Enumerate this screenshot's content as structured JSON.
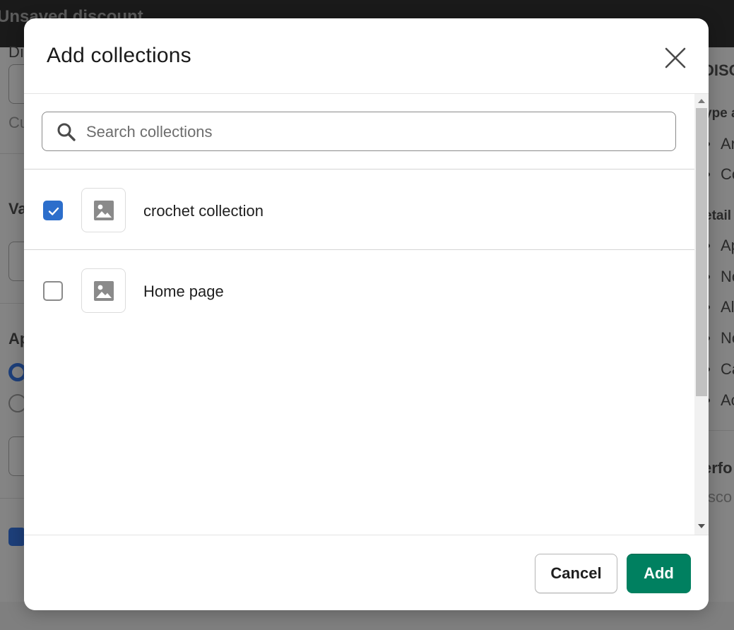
{
  "background": {
    "topbar_title": "Unsaved discount",
    "left_fragments": [
      "Dı",
      "Cu",
      "Va",
      "Ap"
    ],
    "right_heading": "DISC",
    "right_subheads": [
      "ype a",
      "etail",
      "erfo",
      "isco"
    ],
    "right_items": [
      "Ar",
      "Co",
      "Ap",
      "No",
      "Al",
      "No",
      "Ca",
      "Ac"
    ]
  },
  "modal": {
    "title": "Add collections",
    "search": {
      "placeholder": "Search collections",
      "value": ""
    },
    "items": [
      {
        "label": "crochet collection",
        "checked": true
      },
      {
        "label": "Home page",
        "checked": false
      }
    ],
    "footer": {
      "cancel_label": "Cancel",
      "add_label": "Add"
    }
  },
  "colors": {
    "accent": "#2c6ecb",
    "primary_button": "#008060"
  },
  "icons": {
    "close": "close-icon",
    "search": "search-icon",
    "image_placeholder": "image-icon",
    "check": "checkmark-icon"
  }
}
